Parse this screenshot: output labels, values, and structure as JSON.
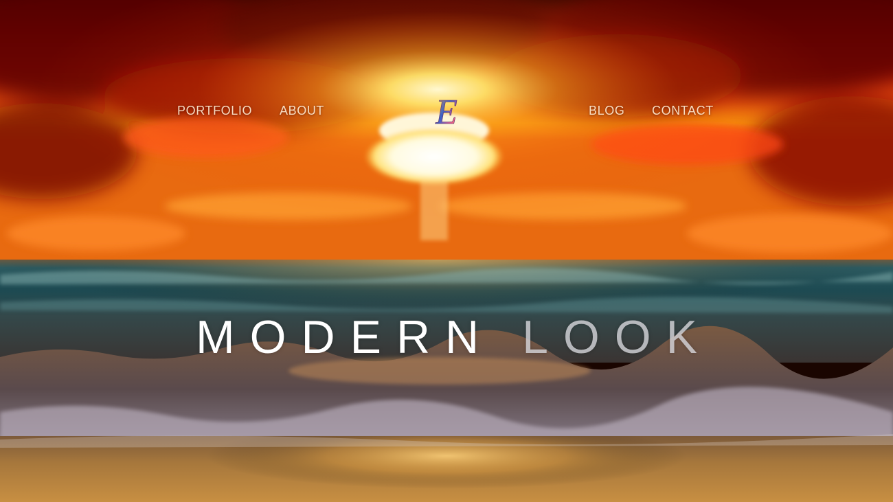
{
  "nav": {
    "items": [
      {
        "label": "PORTFOLIO"
      },
      {
        "label": "ABOUT"
      },
      {
        "label": "BLOG"
      },
      {
        "label": "CONTACT"
      }
    ]
  },
  "logo": {
    "letter": "E",
    "icon": "monogram-e-logo"
  },
  "hero": {
    "headline_word1": "MODERN",
    "headline_word2": "LOOK",
    "background": "sunset-ocean-waves-image"
  },
  "colors": {
    "nav_text": "#ffebd2",
    "headline_primary": "#ffffff",
    "headline_secondary": "#dcdce1",
    "sky_red": "#c0180a",
    "sun_core": "#fffbe6",
    "sea": "#2a4a52",
    "sand": "#a8783a"
  }
}
